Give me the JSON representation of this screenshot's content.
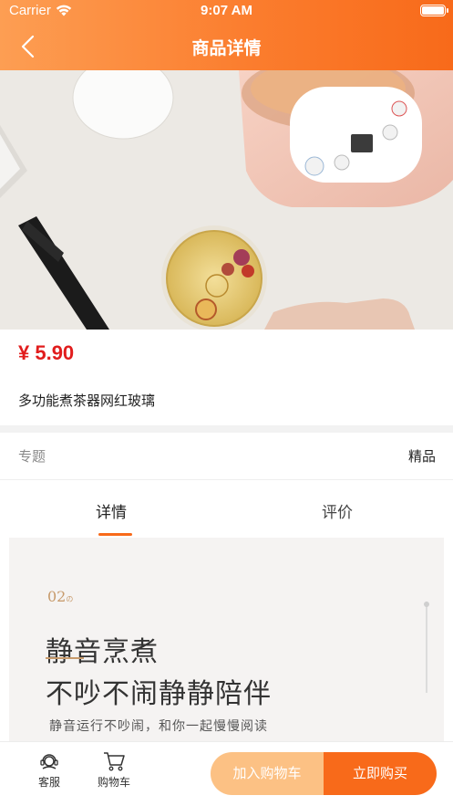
{
  "status_bar": {
    "carrier": "Carrier",
    "time": "9:07 AM"
  },
  "nav": {
    "title": "商品详情"
  },
  "product": {
    "price": "¥ 5.90",
    "title": "多功能煮茶器网红玻璃",
    "topic_label": "专题",
    "topic_value": "精品"
  },
  "tabs": {
    "detail": "详情",
    "review": "评价"
  },
  "detail_image": {
    "number": "02",
    "number_suffix": "の",
    "heading_1": "静音烹煮",
    "heading_2": "不吵不闹静静陪伴",
    "subtitle": "静音运行不吵闹，和你一起慢慢阅读"
  },
  "bottom_bar": {
    "service_label": "客服",
    "cart_label": "购物车",
    "add_to_cart": "加入购物车",
    "buy_now": "立即购买"
  },
  "colors": {
    "accent": "#f86a1a",
    "price": "#e11d1d",
    "add_button": "#fcc184"
  },
  "icons": [
    "wifi-icon",
    "battery-icon",
    "back-chevron-icon",
    "customer-service-icon",
    "cart-icon"
  ]
}
